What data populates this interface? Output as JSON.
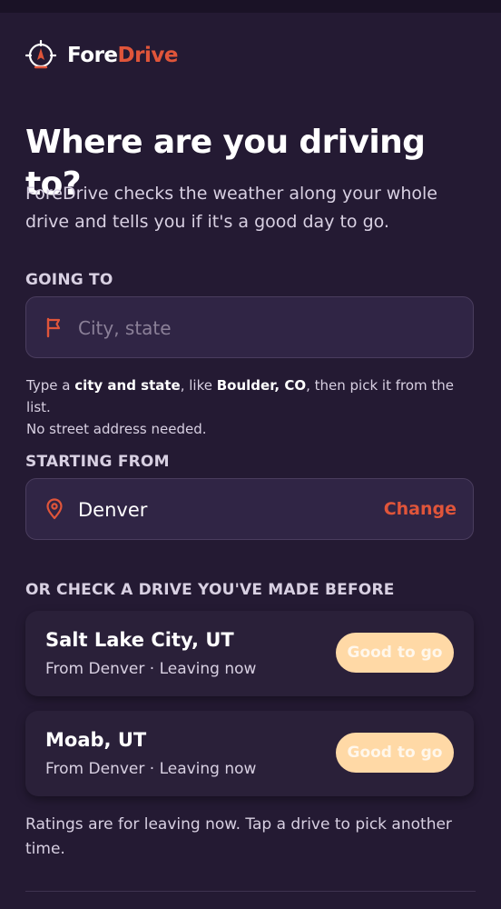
{
  "brand": {
    "name_part1": "Fore",
    "name_part2": "Drive"
  },
  "hero": {
    "title": "Where are you driving to?",
    "subtitle": "ForeDrive checks the weather along your whole drive and tells you if it's a good day to go."
  },
  "destination": {
    "label": "GOING TO",
    "placeholder": "City, state",
    "hint": {
      "part1": "Type a ",
      "bold1": "city and state",
      "part2": ", like ",
      "bold2": "Boulder, CO",
      "part3": ", then pick it from the list.",
      "line2": "No street address needed."
    }
  },
  "origin": {
    "label": "STARTING FROM",
    "value": "Denver",
    "change_label": "Change"
  },
  "recent": {
    "label": "OR CHECK A DRIVE YOU'VE MADE BEFORE",
    "items": [
      {
        "destination": "Salt Lake City, UT",
        "meta": "From Denver · Leaving now",
        "rating": "Good to go"
      },
      {
        "destination": "Moab, UT",
        "meta": "From Denver · Leaving now",
        "rating": "Good to go"
      }
    ]
  },
  "footnote": "Ratings are for leaving now. Tap a drive to pick another time.",
  "colors": {
    "background": "#241a33",
    "accent": "#e0553a",
    "field": "#302545",
    "card": "#2a2039",
    "pill": "#ffd9a6"
  },
  "icons": {
    "logo": "compass-target-icon",
    "destination": "flag-icon",
    "origin": "location-pin-icon"
  }
}
